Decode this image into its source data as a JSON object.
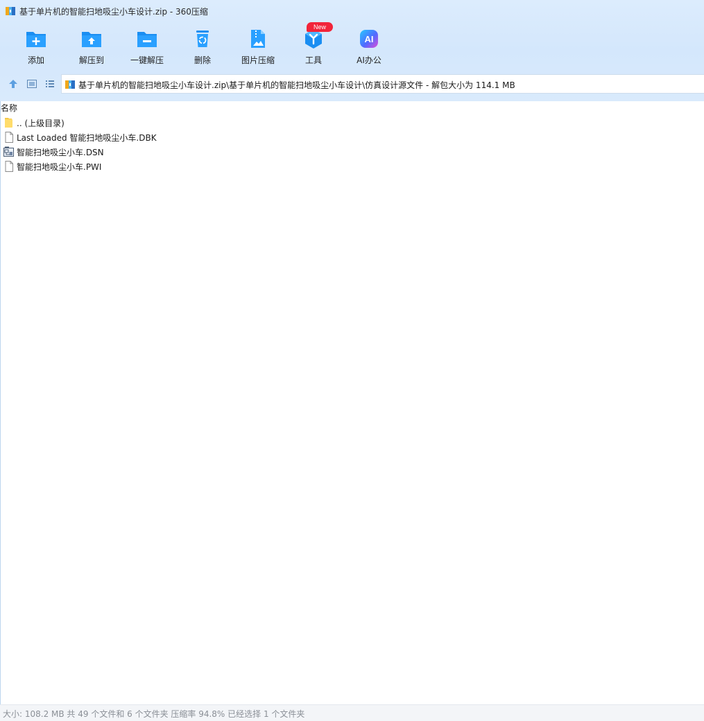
{
  "window": {
    "title": "基于单片机的智能扫地吸尘小车设计.zip - 360压缩"
  },
  "toolbar": {
    "buttons": [
      {
        "label": "添加",
        "icon": "add-folder-icon"
      },
      {
        "label": "解压到",
        "icon": "extract-to-icon"
      },
      {
        "label": "一键解压",
        "icon": "one-click-extract-icon"
      },
      {
        "label": "删除",
        "icon": "trash-icon"
      },
      {
        "label": "图片压缩",
        "icon": "image-compress-icon"
      },
      {
        "label": "工具",
        "icon": "tools-icon"
      },
      {
        "label": "AI办公",
        "icon": "ai-office-icon"
      }
    ],
    "new_badge": "New"
  },
  "address": {
    "path": "基于单片机的智能扫地吸尘小车设计.zip\\基于单片机的智能扫地吸尘小车设计\\仿真设计源文件 - 解包大小为 114.1 MB"
  },
  "filelist": {
    "column_header": "名称",
    "items": [
      {
        "name": ".. (上级目录)",
        "type": "folder"
      },
      {
        "name": "Last Loaded 智能扫地吸尘小车.DBK",
        "type": "file"
      },
      {
        "name": "智能扫地吸尘小车.DSN",
        "type": "dsn-file"
      },
      {
        "name": "智能扫地吸尘小车.PWI",
        "type": "file"
      }
    ]
  },
  "status": {
    "text": "大小: 108.2 MB 共 49 个文件和 6 个文件夹 压缩率 94.8% 已经选择 1 个文件夹"
  },
  "colors": {
    "accent": "#1f8ff0",
    "chrome_bg": "#d6e8fc",
    "badge": "#f2243a"
  }
}
